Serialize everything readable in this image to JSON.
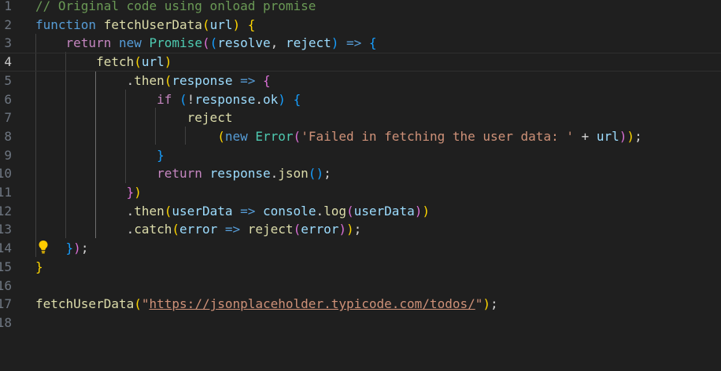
{
  "editor": {
    "language": "javascript",
    "theme_colors": {
      "background": "#1f1f1f",
      "comment": "#6a9955",
      "keyword": "#569cd6",
      "control": "#c586c0",
      "function": "#dcdcaa",
      "variable": "#9cdcfe",
      "class": "#4ec9b0",
      "string": "#ce9178",
      "bracket_1": "#ffd700",
      "bracket_2": "#da70d6",
      "bracket_3": "#179fff"
    },
    "current_line": "4",
    "lightbulb_icon": "lightbulb-icon",
    "lines": [
      {
        "number": "1",
        "tokens": [
          {
            "t": "// Original code using onload promise",
            "c": "cm"
          }
        ]
      },
      {
        "number": "2",
        "tokens": [
          {
            "t": "function",
            "c": "kw"
          },
          {
            "t": " ",
            "c": "pun"
          },
          {
            "t": "fetchUserData",
            "c": "fn"
          },
          {
            "t": "(",
            "c": "p1"
          },
          {
            "t": "url",
            "c": "var"
          },
          {
            "t": ")",
            "c": "p1"
          },
          {
            "t": " ",
            "c": "pun"
          },
          {
            "t": "{",
            "c": "p1"
          }
        ]
      },
      {
        "number": "3",
        "tokens": [
          {
            "t": "    ",
            "c": "pun"
          },
          {
            "t": "return",
            "c": "ctl"
          },
          {
            "t": " ",
            "c": "pun"
          },
          {
            "t": "new",
            "c": "kw"
          },
          {
            "t": " ",
            "c": "pun"
          },
          {
            "t": "Promise",
            "c": "cls"
          },
          {
            "t": "(",
            "c": "p2"
          },
          {
            "t": "(",
            "c": "p3"
          },
          {
            "t": "resolve",
            "c": "var"
          },
          {
            "t": ", ",
            "c": "pun"
          },
          {
            "t": "reject",
            "c": "var"
          },
          {
            "t": ")",
            "c": "p3"
          },
          {
            "t": " ",
            "c": "pun"
          },
          {
            "t": "=>",
            "c": "kw"
          },
          {
            "t": " ",
            "c": "pun"
          },
          {
            "t": "{",
            "c": "p3"
          }
        ]
      },
      {
        "number": "4",
        "tokens": [
          {
            "t": "        ",
            "c": "pun"
          },
          {
            "t": "fetch",
            "c": "fn"
          },
          {
            "t": "(",
            "c": "p1"
          },
          {
            "t": "url",
            "c": "var"
          },
          {
            "t": ")",
            "c": "p1"
          }
        ]
      },
      {
        "number": "5",
        "tokens": [
          {
            "t": "            ",
            "c": "pun"
          },
          {
            "t": ".",
            "c": "pun"
          },
          {
            "t": "then",
            "c": "fn"
          },
          {
            "t": "(",
            "c": "p1"
          },
          {
            "t": "response",
            "c": "var"
          },
          {
            "t": " ",
            "c": "pun"
          },
          {
            "t": "=>",
            "c": "kw"
          },
          {
            "t": " ",
            "c": "pun"
          },
          {
            "t": "{",
            "c": "p2"
          }
        ]
      },
      {
        "number": "6",
        "tokens": [
          {
            "t": "                ",
            "c": "pun"
          },
          {
            "t": "if",
            "c": "ctl"
          },
          {
            "t": " ",
            "c": "pun"
          },
          {
            "t": "(",
            "c": "p3"
          },
          {
            "t": "!",
            "c": "pun"
          },
          {
            "t": "response",
            "c": "var"
          },
          {
            "t": ".",
            "c": "pun"
          },
          {
            "t": "ok",
            "c": "var"
          },
          {
            "t": ")",
            "c": "p3"
          },
          {
            "t": " ",
            "c": "pun"
          },
          {
            "t": "{",
            "c": "p3"
          }
        ]
      },
      {
        "number": "7",
        "tokens": [
          {
            "t": "                    ",
            "c": "pun"
          },
          {
            "t": "reject",
            "c": "fn"
          }
        ]
      },
      {
        "number": "8",
        "tokens": [
          {
            "t": "                        ",
            "c": "pun"
          },
          {
            "t": "(",
            "c": "p1"
          },
          {
            "t": "new",
            "c": "kw"
          },
          {
            "t": " ",
            "c": "pun"
          },
          {
            "t": "Error",
            "c": "cls"
          },
          {
            "t": "(",
            "c": "p2"
          },
          {
            "t": "'Failed in fetching the user data: '",
            "c": "str"
          },
          {
            "t": " + ",
            "c": "pun"
          },
          {
            "t": "url",
            "c": "var"
          },
          {
            "t": ")",
            "c": "p2"
          },
          {
            "t": ")",
            "c": "p1"
          },
          {
            "t": ";",
            "c": "pun"
          }
        ]
      },
      {
        "number": "9",
        "tokens": [
          {
            "t": "                ",
            "c": "pun"
          },
          {
            "t": "}",
            "c": "p3"
          }
        ]
      },
      {
        "number": "10",
        "tokens": [
          {
            "t": "                ",
            "c": "pun"
          },
          {
            "t": "return",
            "c": "ctl"
          },
          {
            "t": " ",
            "c": "pun"
          },
          {
            "t": "response",
            "c": "var"
          },
          {
            "t": ".",
            "c": "pun"
          },
          {
            "t": "json",
            "c": "fn"
          },
          {
            "t": "(",
            "c": "p3"
          },
          {
            "t": ")",
            "c": "p3"
          },
          {
            "t": ";",
            "c": "pun"
          }
        ]
      },
      {
        "number": "11",
        "tokens": [
          {
            "t": "            ",
            "c": "pun"
          },
          {
            "t": "}",
            "c": "p2"
          },
          {
            "t": ")",
            "c": "p1"
          }
        ]
      },
      {
        "number": "12",
        "tokens": [
          {
            "t": "            ",
            "c": "pun"
          },
          {
            "t": ".",
            "c": "pun"
          },
          {
            "t": "then",
            "c": "fn"
          },
          {
            "t": "(",
            "c": "p1"
          },
          {
            "t": "userData",
            "c": "var"
          },
          {
            "t": " ",
            "c": "pun"
          },
          {
            "t": "=>",
            "c": "kw"
          },
          {
            "t": " ",
            "c": "pun"
          },
          {
            "t": "console",
            "c": "var"
          },
          {
            "t": ".",
            "c": "pun"
          },
          {
            "t": "log",
            "c": "fn"
          },
          {
            "t": "(",
            "c": "p2"
          },
          {
            "t": "userData",
            "c": "var"
          },
          {
            "t": ")",
            "c": "p2"
          },
          {
            "t": ")",
            "c": "p1"
          }
        ]
      },
      {
        "number": "13",
        "tokens": [
          {
            "t": "            ",
            "c": "pun"
          },
          {
            "t": ".",
            "c": "pun"
          },
          {
            "t": "catch",
            "c": "fn"
          },
          {
            "t": "(",
            "c": "p1"
          },
          {
            "t": "error",
            "c": "var"
          },
          {
            "t": " ",
            "c": "pun"
          },
          {
            "t": "=>",
            "c": "kw"
          },
          {
            "t": " ",
            "c": "pun"
          },
          {
            "t": "reject",
            "c": "fn"
          },
          {
            "t": "(",
            "c": "p2"
          },
          {
            "t": "error",
            "c": "var"
          },
          {
            "t": ")",
            "c": "p2"
          },
          {
            "t": ")",
            "c": "p1"
          },
          {
            "t": ";",
            "c": "pun"
          }
        ]
      },
      {
        "number": "14",
        "tokens": [
          {
            "t": "    ",
            "c": "pun"
          },
          {
            "t": "}",
            "c": "p3"
          },
          {
            "t": ")",
            "c": "p2"
          },
          {
            "t": ";",
            "c": "pun"
          }
        ]
      },
      {
        "number": "15",
        "tokens": [
          {
            "t": "}",
            "c": "p1"
          }
        ]
      },
      {
        "number": "16",
        "tokens": []
      },
      {
        "number": "17",
        "tokens": [
          {
            "t": "fetchUserData",
            "c": "fn"
          },
          {
            "t": "(",
            "c": "p1"
          },
          {
            "t": "\"",
            "c": "str"
          },
          {
            "t": "https://jsonplaceholder.typicode.com/todos/",
            "c": "url"
          },
          {
            "t": "\"",
            "c": "str"
          },
          {
            "t": ")",
            "c": "p1"
          },
          {
            "t": ";",
            "c": "pun"
          }
        ]
      },
      {
        "number": "18",
        "tokens": []
      }
    ]
  }
}
